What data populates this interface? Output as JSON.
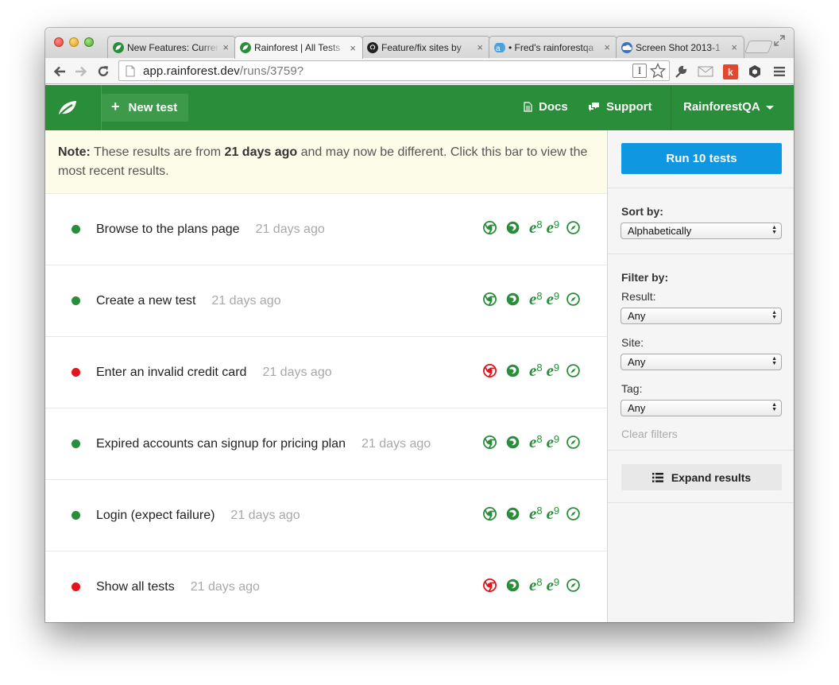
{
  "browser": {
    "tabs": [
      {
        "title": "New Features: Current Sprint",
        "active": false
      },
      {
        "title": "Rainforest | All Tests",
        "active": true
      },
      {
        "title": "Feature/fix sites by",
        "active": false
      },
      {
        "title": "• Fred's rainforestqa",
        "active": false
      },
      {
        "title": "Screen Shot 2013-1",
        "active": false
      }
    ],
    "tab_close": "×",
    "url_host": "app.rainforest.dev",
    "url_path": "/runs/3759?",
    "ibeam": "I"
  },
  "header": {
    "new_test_plus": "+",
    "new_test_label": "New test",
    "docs_label": "Docs",
    "support_label": "Support",
    "account_label": "RainforestQA"
  },
  "note": {
    "prefix": "Note:",
    "text_1": " These results are from ",
    "age": "21 days ago",
    "text_2": " and may now be different. Click this bar to view the most recent results."
  },
  "tests": [
    {
      "name": "Browse to the plans page",
      "time": "21 days ago",
      "status": "pass",
      "chrome": "pass"
    },
    {
      "name": "Create a new test",
      "time": "21 days ago",
      "status": "pass",
      "chrome": "pass"
    },
    {
      "name": "Enter an invalid credit card",
      "time": "21 days ago",
      "status": "fail",
      "chrome": "fail"
    },
    {
      "name": "Expired accounts can signup for pricing plan",
      "time": "21 days ago",
      "status": "pass",
      "chrome": "pass"
    },
    {
      "name": "Login (expect failure)",
      "time": "21 days ago",
      "status": "pass",
      "chrome": "pass"
    },
    {
      "name": "Show all tests",
      "time": "21 days ago",
      "status": "fail",
      "chrome": "fail"
    }
  ],
  "browser_icons": {
    "ie_glyph": "e",
    "ie8": "8",
    "ie9": "9"
  },
  "sidebar": {
    "run_label": "Run 10 tests",
    "sort_label": "Sort by:",
    "sort_value": "Alphabetically",
    "filter_label": "Filter by:",
    "result_label": "Result:",
    "result_value": "Any",
    "site_label": "Site:",
    "site_value": "Any",
    "tag_label": "Tag:",
    "tag_value": "Any",
    "clear_label": "Clear filters",
    "expand_label": "Expand results"
  },
  "colors": {
    "brand_green": "#2a8d3a",
    "run_blue": "#0f97e1",
    "fail_red": "#e4131c",
    "note_bg": "#fcfce9"
  }
}
